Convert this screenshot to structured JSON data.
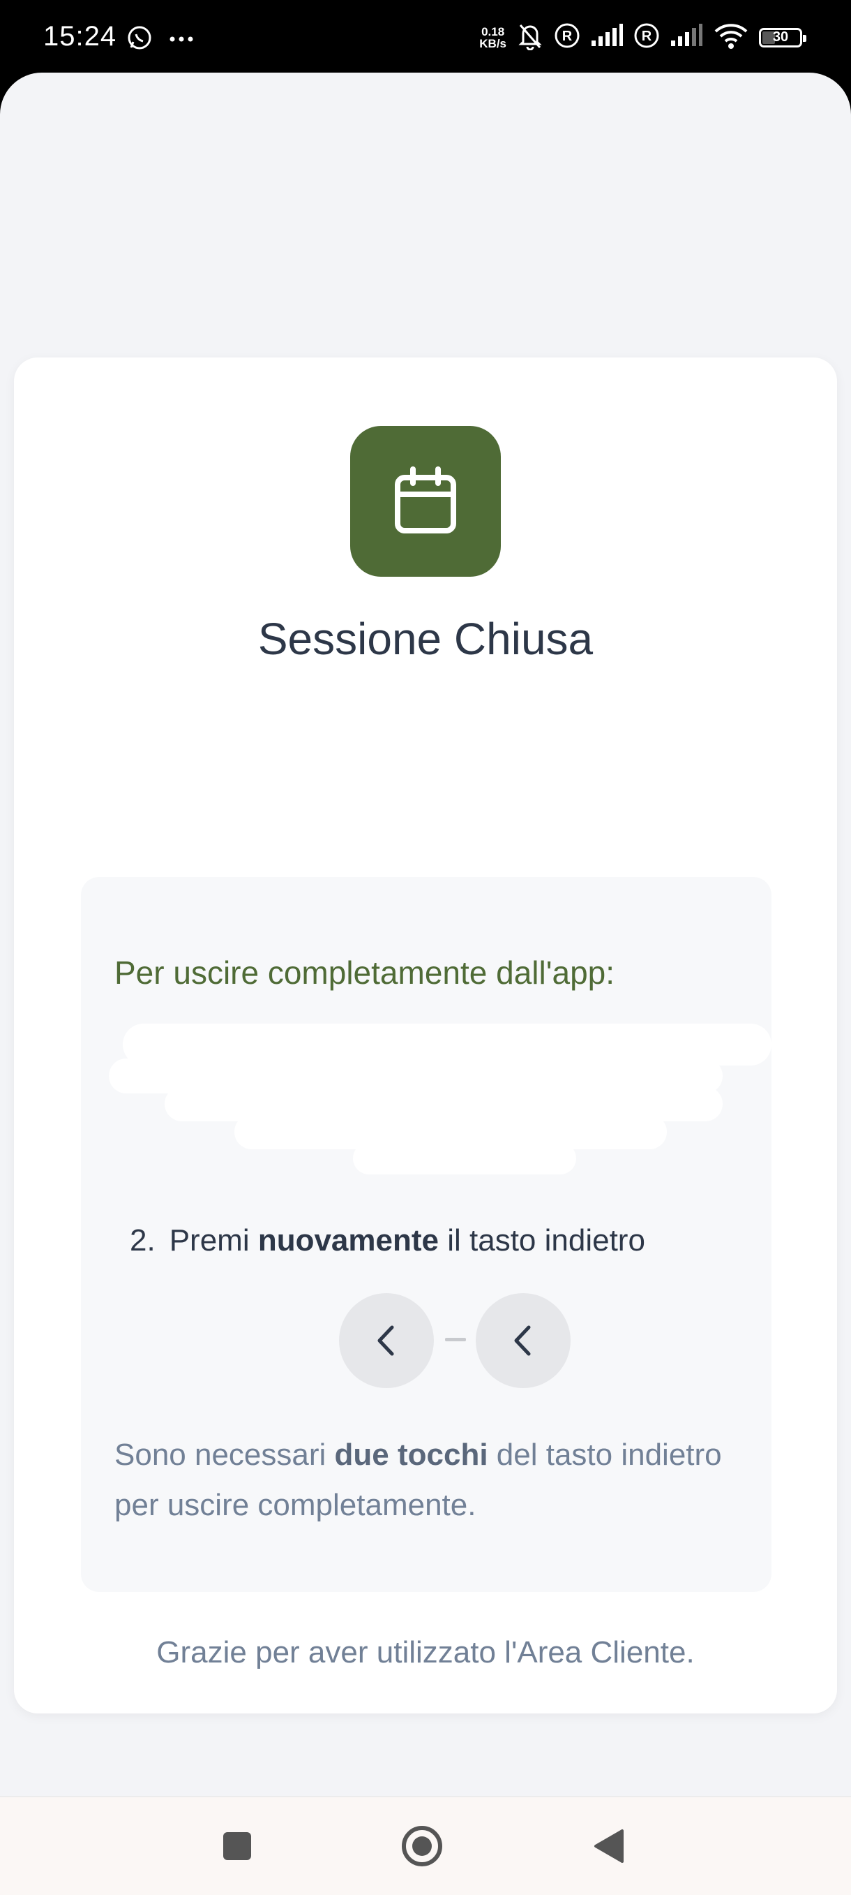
{
  "status_bar": {
    "time": "15:24",
    "net_speed_value": "0.18",
    "net_speed_unit": "KB/s",
    "battery_level": "30"
  },
  "card": {
    "title": "Sessione Chiusa",
    "info_heading": "Per uscire completamente dall'app:",
    "step2": {
      "number": "2.",
      "prefix": "Premi ",
      "bold": "nuovamente",
      "suffix": " il tasto indietro"
    },
    "note": {
      "prefix": "Sono necessari ",
      "bold": "due tocchi",
      "suffix": " del tasto indietro per uscire completamente."
    },
    "thanks": "Grazie per aver utilizzato l'Area Cliente."
  },
  "colors": {
    "accent": "#4f6b36",
    "title": "#2d3748",
    "muted": "#718096"
  },
  "icons": {
    "app_icon": "calendar-icon",
    "back": "chevron-left-icon"
  }
}
